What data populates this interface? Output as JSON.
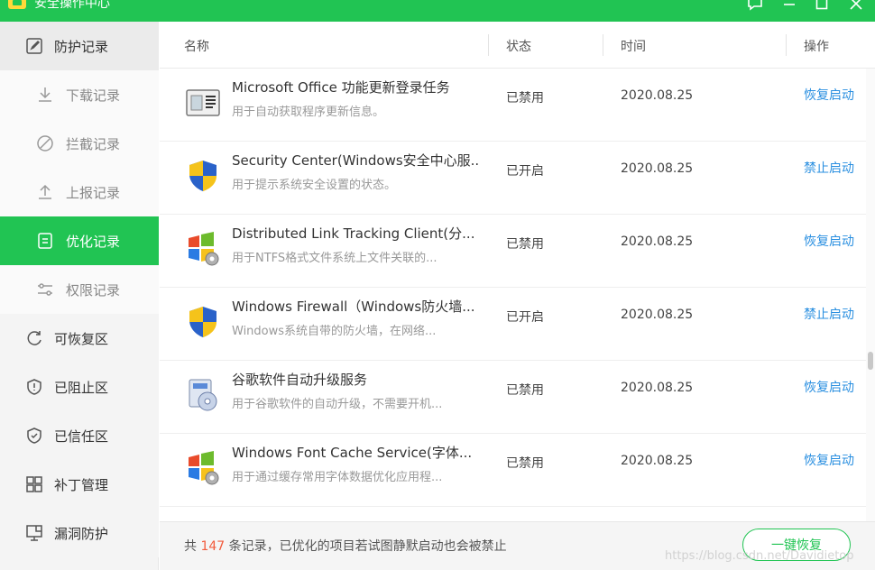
{
  "window": {
    "title": "安全操作中心"
  },
  "colors": {
    "accent": "#21c453",
    "link": "#2a8fe0",
    "count": "#f25c3d"
  },
  "sidebar": {
    "items": [
      {
        "label": "防护记录",
        "icon": "document-edit-icon",
        "level": "top",
        "active": false
      },
      {
        "label": "下载记录",
        "icon": "download-icon",
        "level": "sub",
        "active": false
      },
      {
        "label": "拦截记录",
        "icon": "block-icon",
        "level": "sub",
        "active": false
      },
      {
        "label": "上报记录",
        "icon": "upload-icon",
        "level": "sub",
        "active": false
      },
      {
        "label": "优化记录",
        "icon": "list-icon",
        "level": "sub",
        "active": true
      },
      {
        "label": "权限记录",
        "icon": "sliders-icon",
        "level": "sub",
        "active": false
      },
      {
        "label": "可恢复区",
        "icon": "refresh-icon",
        "level": "top",
        "active": false
      },
      {
        "label": "已阻止区",
        "icon": "shield-alert-icon",
        "level": "top",
        "active": false
      },
      {
        "label": "已信任区",
        "icon": "shield-check-icon",
        "level": "top",
        "active": false
      },
      {
        "label": "补丁管理",
        "icon": "grid-icon",
        "level": "top",
        "active": false
      },
      {
        "label": "漏洞防护",
        "icon": "monitor-icon",
        "level": "top",
        "active": false
      }
    ]
  },
  "table": {
    "headers": {
      "name": "名称",
      "status": "状态",
      "time": "时间",
      "action": "操作"
    },
    "rows": [
      {
        "icon": "office-task-icon",
        "name": "Microsoft Office 功能更新登录任务",
        "desc": "用于自动获取程序更新信息。",
        "status": "已禁用",
        "time": "2020.08.25",
        "action": "恢复启动"
      },
      {
        "icon": "shield-uac-icon",
        "name": "Security Center(Windows安全中心服...",
        "desc": "用于提示系统安全设置的状态。",
        "status": "已开启",
        "time": "2020.08.25",
        "action": "禁止启动"
      },
      {
        "icon": "windows-gear-icon",
        "name": "Distributed Link Tracking Client(分...",
        "desc": "用于NTFS格式文件系统上文件关联的...",
        "status": "已禁用",
        "time": "2020.08.25",
        "action": "恢复启动"
      },
      {
        "icon": "shield-uac-icon",
        "name": "Windows Firewall（Windows防火墙...",
        "desc": "Windows系统自带的防火墙，在网络...",
        "status": "已开启",
        "time": "2020.08.25",
        "action": "禁止启动"
      },
      {
        "icon": "installer-disc-icon",
        "name": "谷歌软件自动升级服务",
        "desc": "用于谷歌软件的自动升级，不需要开机...",
        "status": "已禁用",
        "time": "2020.08.25",
        "action": "恢复启动"
      },
      {
        "icon": "windows-gear-icon",
        "name": "Windows Font Cache Service(字体...",
        "desc": "用于通过缓存常用字体数据优化应用程...",
        "status": "已禁用",
        "time": "2020.08.25",
        "action": "恢复启动"
      }
    ]
  },
  "footer": {
    "prefix": "共",
    "count": "147",
    "suffix": "条记录，已优化的项目若试图静默启动也会被禁止",
    "button": "一键恢复",
    "watermark": "https://blog.csdn.net/Davidietop"
  }
}
